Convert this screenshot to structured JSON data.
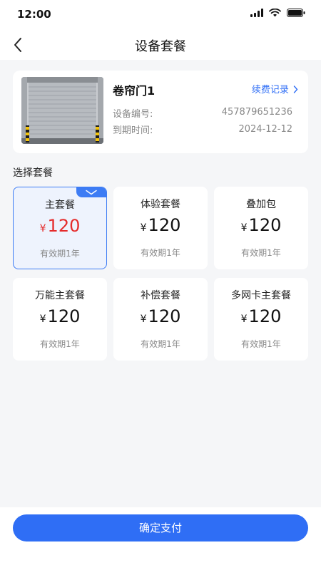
{
  "status": {
    "time": "12:00"
  },
  "nav": {
    "title": "设备套餐"
  },
  "device": {
    "name": "卷帘门1",
    "renew_link": "续费记录",
    "serial_label": "设备编号:",
    "serial_value": "457879651236",
    "expiry_label": "到期时间:",
    "expiry_value": "2024-12-12"
  },
  "section_title": "选择套餐",
  "currency": "¥",
  "plans": [
    {
      "name": "主套餐",
      "price": "120",
      "validity": "有效期1年",
      "selected": true
    },
    {
      "name": "体验套餐",
      "price": "120",
      "validity": "有效期1年",
      "selected": false
    },
    {
      "name": "叠加包",
      "price": "120",
      "validity": "有效期1年",
      "selected": false
    },
    {
      "name": "万能主套餐",
      "price": "120",
      "validity": "有效期1年",
      "selected": false
    },
    {
      "name": "补偿套餐",
      "price": "120",
      "validity": "有效期1年",
      "selected": false
    },
    {
      "name": "多网卡主套餐",
      "price": "120",
      "validity": "有效期1年",
      "selected": false
    }
  ],
  "pay_button": "确定支付",
  "colors": {
    "accent": "#2f6ef5",
    "price_selected": "#e52b2b",
    "background": "#f5f6f8"
  }
}
